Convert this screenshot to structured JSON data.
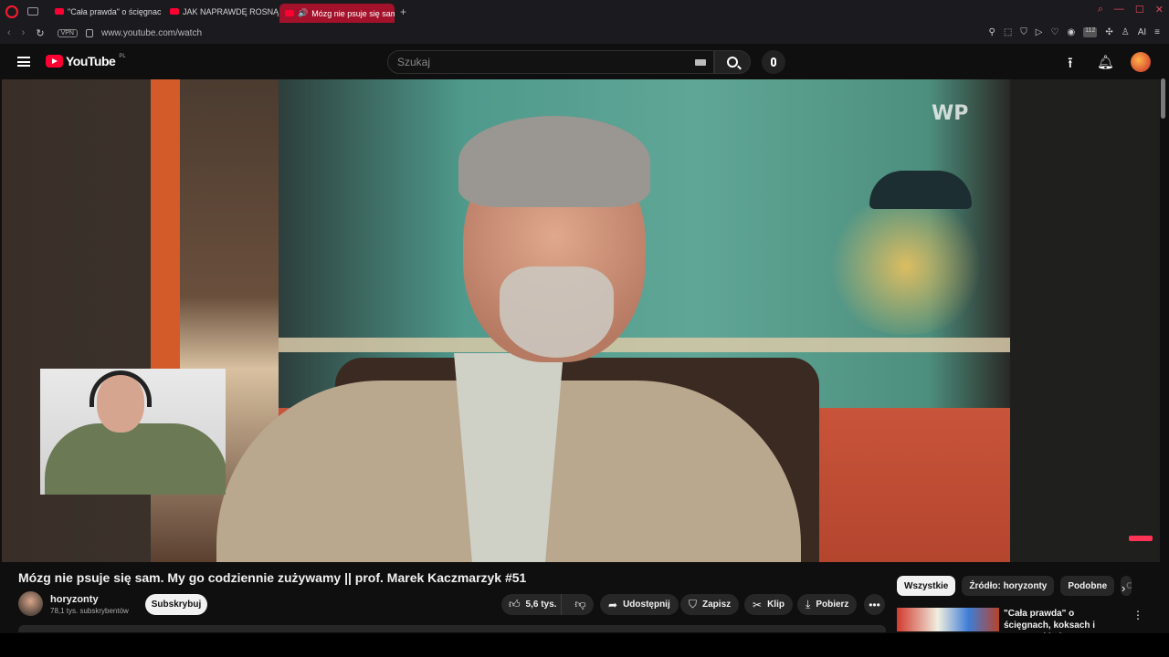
{
  "browser": {
    "tabs": [
      {
        "label": "\"Cała prawda\" o ścięgnac",
        "active": false
      },
      {
        "label": "JAK NAPRAWDĘ ROSNĄ M",
        "active": false
      },
      {
        "label": "Mózg nie psuje się sam",
        "active": true
      }
    ],
    "new_tab": "+",
    "vpn": "VPN",
    "url": "www.youtube.com/watch",
    "ai_label": "AI",
    "badge_count": "112"
  },
  "header": {
    "logo_text": "YouTube",
    "country_code": "PL",
    "search_placeholder": "Szukaj"
  },
  "video": {
    "watermark": "WP"
  },
  "info": {
    "title": "Mózg nie psuje się sam. My go codziennie zużywamy || prof. Marek Kaczmarzyk #51",
    "channel_name": "horyzonty",
    "subscribers": "78,1 tys. subskrybentów",
    "subscribe_label": "Subskrybuj",
    "likes": "5,6 tys.",
    "share_label": "Udostępnij",
    "save_label": "Zapisz",
    "clip_label": "Klip",
    "download_label": "Pobierz"
  },
  "sidebar": {
    "chips": [
      "Wszystkie",
      "Źródło: horyzonty",
      "Podobne",
      "O"
    ],
    "recommendation_title": "\"Cała prawda\" o ścięgnach, koksach i structural balance."
  },
  "colors": {
    "accent": "#ff0033",
    "background": "#0f0f0f",
    "opera_tab": "#a3122a"
  }
}
